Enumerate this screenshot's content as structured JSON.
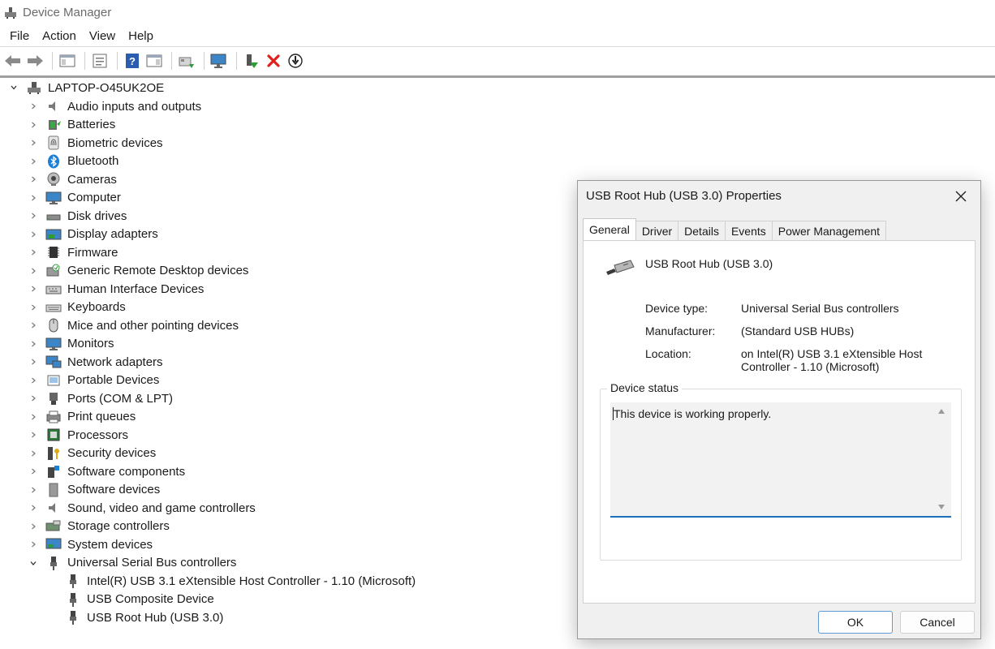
{
  "window": {
    "title": "Device Manager"
  },
  "menu": [
    "File",
    "Action",
    "View",
    "Help"
  ],
  "toolbar": {
    "buttons": [
      "back-icon",
      "forward-icon",
      "show-hide-tree-icon",
      "properties-icon",
      "help-icon",
      "action-pane-icon",
      "update-driver-icon",
      "scan-hardware-icon",
      "enable-device-icon",
      "uninstall-icon",
      "disable-device-icon"
    ]
  },
  "tree": {
    "root": "LAPTOP-O45UK2OE",
    "categories": [
      "Audio inputs and outputs",
      "Batteries",
      "Biometric devices",
      "Bluetooth",
      "Cameras",
      "Computer",
      "Disk drives",
      "Display adapters",
      "Firmware",
      "Generic Remote Desktop devices",
      "Human Interface Devices",
      "Keyboards",
      "Mice and other pointing devices",
      "Monitors",
      "Network adapters",
      "Portable Devices",
      "Ports (COM & LPT)",
      "Print queues",
      "Processors",
      "Security devices",
      "Software components",
      "Software devices",
      "Sound, video and game controllers",
      "Storage controllers",
      "System devices",
      "Universal Serial Bus controllers"
    ],
    "usb_children": [
      "Intel(R) USB 3.1 eXtensible Host Controller - 1.10 (Microsoft)",
      "USB Composite Device",
      "USB Root Hub (USB 3.0)"
    ]
  },
  "dialog": {
    "title": "USB Root Hub (USB 3.0) Properties",
    "tabs": [
      "General",
      "Driver",
      "Details",
      "Events",
      "Power Management"
    ],
    "device_name": "USB Root Hub (USB 3.0)",
    "props": {
      "type_label": "Device type:",
      "type_value": "Universal Serial Bus controllers",
      "manufacturer_label": "Manufacturer:",
      "manufacturer_value": "(Standard USB HUBs)",
      "location_label": "Location:",
      "location_value": "on Intel(R) USB 3.1 eXtensible Host Controller - 1.10 (Microsoft)"
    },
    "status_legend": "Device status",
    "status_text": "This device is working properly.",
    "ok_label": "OK",
    "cancel_label": "Cancel"
  }
}
